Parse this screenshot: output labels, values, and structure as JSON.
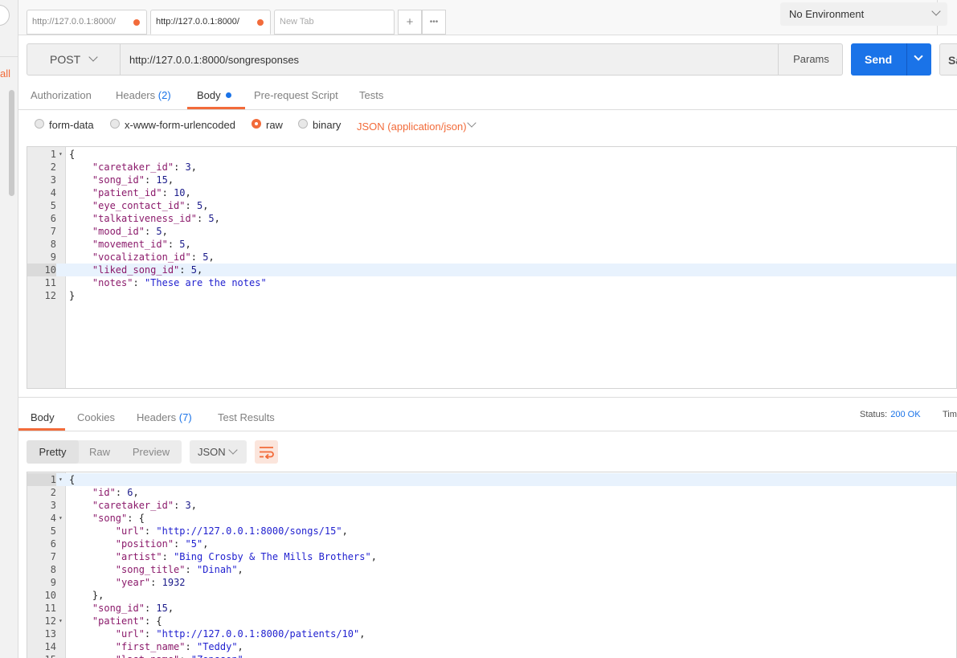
{
  "sidebar": {
    "all_label": "all"
  },
  "tabs": [
    {
      "label": "http://127.0.0.1:8000/"
    },
    {
      "label": "http://127.0.0.1:8000/"
    },
    {
      "label": "New Tab"
    }
  ],
  "tab_actions": {
    "add": "+",
    "more": "•••"
  },
  "environment": {
    "selected": "No Environment"
  },
  "request": {
    "method": "POST",
    "url": "http://127.0.0.1:8000/songresponses",
    "params_label": "Params",
    "send_label": "Send",
    "save_label": "Sa"
  },
  "request_tabs": {
    "authorization": "Authorization",
    "headers": "Headers",
    "headers_count": "(2)",
    "body": "Body",
    "prerequest": "Pre-request Script",
    "tests": "Tests"
  },
  "body_types": {
    "form_data": "form-data",
    "urlencoded": "x-www-form-urlencoded",
    "raw": "raw",
    "binary": "binary",
    "content_type": "JSON (application/json)"
  },
  "request_body_lines": [
    "{",
    "    \"caretaker_id\": 3,",
    "    \"song_id\": 15,",
    "    \"patient_id\": 10,",
    "    \"eye_contact_id\": 5,",
    "    \"talkativeness_id\": 5,",
    "    \"mood_id\": 5,",
    "    \"movement_id\": 5,",
    "    \"vocalization_id\": 5,",
    "    \"liked_song_id\": 5,",
    "    \"notes\": \"These are the notes\"",
    "}"
  ],
  "response_tabs": {
    "body": "Body",
    "cookies": "Cookies",
    "headers": "Headers",
    "headers_count": "(7)",
    "test_results": "Test Results"
  },
  "response_status": {
    "label": "Status:",
    "value": "200 OK",
    "time_label": "Tim"
  },
  "response_view": {
    "pretty": "Pretty",
    "raw": "Raw",
    "preview": "Preview",
    "format": "JSON"
  },
  "response_body_lines": [
    "{",
    "    \"id\": 6,",
    "    \"caretaker_id\": 3,",
    "    \"song\": {",
    "        \"url\": \"http://127.0.0.1:8000/songs/15\",",
    "        \"position\": \"5\",",
    "        \"artist\": \"Bing Crosby & The Mills Brothers\",",
    "        \"song_title\": \"Dinah\",",
    "        \"year\": 1932",
    "    },",
    "    \"song_id\": 15,",
    "    \"patient\": {",
    "        \"url\": \"http://127.0.0.1:8000/patients/10\",",
    "        \"first_name\": \"Teddy\",",
    "        \"last_name\": \"Zopsson\""
  ],
  "colors": {
    "accent": "#f26b3a",
    "primary": "#1a73e8"
  }
}
